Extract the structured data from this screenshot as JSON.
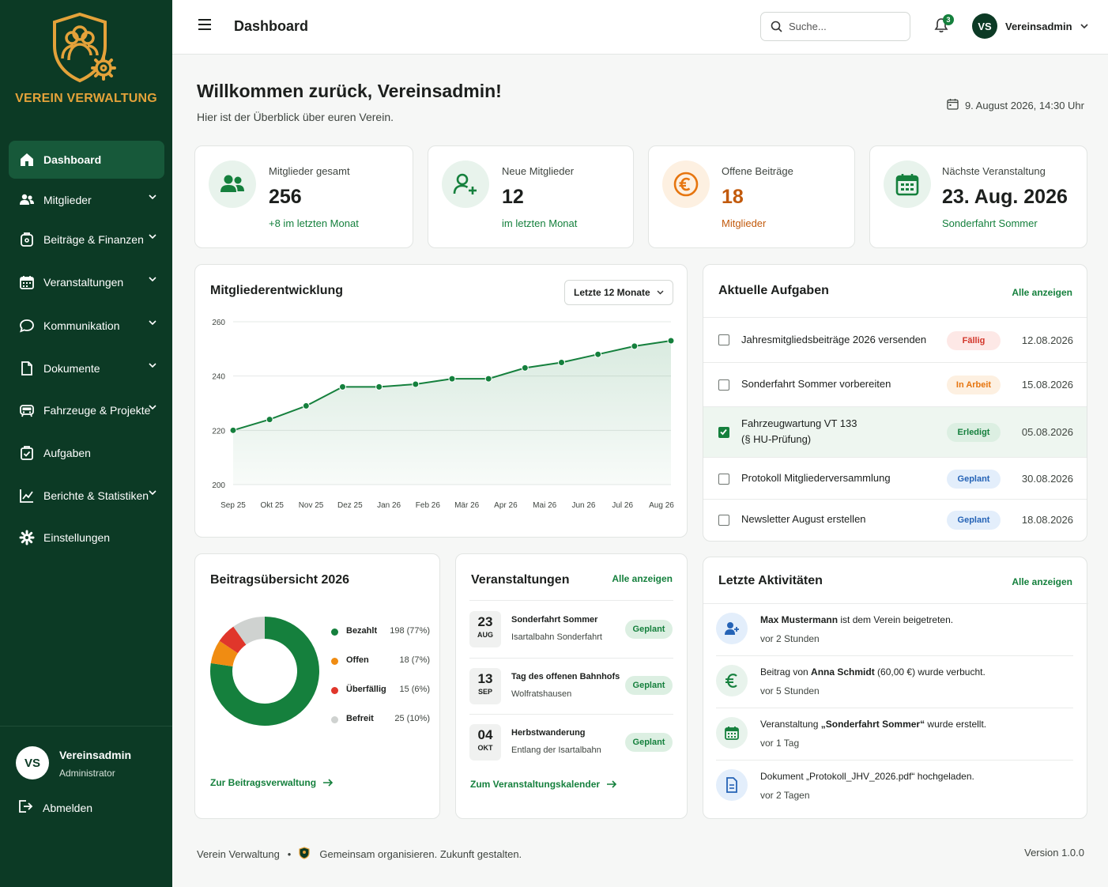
{
  "app": {
    "name": "VEREIN VERWALTUNG",
    "accent": "#15803d",
    "sidebar_bg": "#0c3a25",
    "brand_gold": "#e4a23a"
  },
  "sidebar": {
    "items": [
      {
        "label": "Dashboard",
        "icon": "home-icon",
        "active": true
      },
      {
        "label": "Mitglieder",
        "icon": "users-icon"
      },
      {
        "label": "Beiträge & Finanzen",
        "icon": "wallet-icon"
      },
      {
        "label": "Veranstaltungen",
        "icon": "calendar-icon"
      },
      {
        "label": "Kommunikation",
        "icon": "chat-icon"
      },
      {
        "label": "Dokumente",
        "icon": "document-icon"
      },
      {
        "label": "Fahrzeuge & Projekte",
        "icon": "vehicle-icon"
      },
      {
        "label": "Aufgaben",
        "icon": "task-icon"
      },
      {
        "label": "Berichte & Statistiken",
        "icon": "chart-icon"
      },
      {
        "label": "Einstellungen",
        "icon": "gear-icon"
      }
    ],
    "user": {
      "initials": "VS",
      "name": "Vereinsadmin",
      "role": "Administrator"
    },
    "logout_label": "Abmelden"
  },
  "topbar": {
    "title": "Dashboard",
    "search_placeholder": "Suche...",
    "notifications": "3",
    "user_initials": "VS",
    "user_name": "Vereinsadmin"
  },
  "welcome": {
    "title": "Willkommen zurück, Vereinsadmin!",
    "subtitle": "Hier ist der Überblick über euren Verein.",
    "datetime": "9. August 2026, 14:30 Uhr"
  },
  "stats": [
    {
      "label": "Mitglieder gesamt",
      "value": "256",
      "note": "+8 im letzten Monat"
    },
    {
      "label": "Neue Mitglieder",
      "value": "12",
      "note": "im letzten Monat"
    },
    {
      "label": "Offene Beiträge",
      "value": "18",
      "note": "Mitglieder"
    },
    {
      "label": "Nächste Veranstaltung",
      "value": "23. Aug. 2026",
      "note": "Sonderfahrt Sommer"
    }
  ],
  "member_chart": {
    "title": "Mitgliederentwicklung",
    "range_label": "Letzte 12 Monate"
  },
  "chart_data": {
    "type": "area",
    "categories": [
      "Sep 25",
      "Okt 25",
      "Nov 25",
      "Dez 25",
      "Jan 26",
      "Feb 26",
      "Mär 26",
      "Apr 26",
      "Mai 26",
      "Jun 26",
      "Jul 26",
      "Aug 26"
    ],
    "series": [
      {
        "values": [
          220,
          224,
          229,
          236,
          236,
          237,
          239,
          239,
          243,
          245,
          248,
          251,
          253
        ]
      }
    ],
    "yticks": [
      200,
      220,
      240,
      260
    ],
    "ylim": [
      200,
      260
    ],
    "grid": true,
    "color": "#15803d"
  },
  "tasks": {
    "title": "Aktuelle Aufgaben",
    "link": "Alle anzeigen",
    "items": [
      {
        "text": "Jahresmitgliedsbeiträge 2026 versenden",
        "status": "Fällig",
        "date": "12.08.2026",
        "done": false
      },
      {
        "text": "Sonderfahrt Sommer vorbereiten",
        "status": "In Arbeit",
        "date": "15.08.2026",
        "done": false
      },
      {
        "text": "Fahrzeugwartung VT 133",
        "text2": "(§ HU-Prüfung)",
        "status": "Erledigt",
        "date": "05.08.2026",
        "done": true
      },
      {
        "text": "Protokoll Mitgliederversammlung",
        "status": "Geplant",
        "date": "30.08.2026",
        "done": false
      },
      {
        "text": "Newsletter August erstellen",
        "status": "Geplant",
        "date": "18.08.2026",
        "done": false
      }
    ]
  },
  "fees": {
    "title": "Beitragsübersicht 2026",
    "link": "Zur Beitragsverwaltung",
    "legend": [
      {
        "label": "Bezahlt",
        "value": "198 (77%)",
        "count": 198,
        "color": "#15803d"
      },
      {
        "label": "Offen",
        "value": "18 (7%)",
        "count": 18,
        "color": "#f08c12"
      },
      {
        "label": "Überfällig",
        "value": "15 (6%)",
        "count": 15,
        "color": "#e0362b"
      },
      {
        "label": "Befreit",
        "value": "25 (10%)",
        "count": 25,
        "color": "#cfd2d0"
      }
    ]
  },
  "events": {
    "title": "Veranstaltungen",
    "link": "Alle anzeigen",
    "footer_link": "Zum Veranstaltungskalender",
    "items": [
      {
        "day": "23",
        "month": "AUG",
        "title": "Sonderfahrt Sommer",
        "place": "Isartalbahn Sonderfahrt",
        "status": "Geplant"
      },
      {
        "day": "13",
        "month": "SEP",
        "title": "Tag des offenen Bahnhofs",
        "place": "Wolfratshausen",
        "status": "Geplant"
      },
      {
        "day": "04",
        "month": "OKT",
        "title": "Herbstwanderung",
        "place": "Entlang der Isartalbahn",
        "status": "Geplant"
      }
    ]
  },
  "activities": {
    "title": "Letzte Aktivitäten",
    "link": "Alle anzeigen",
    "items": [
      {
        "bold": "Max Mustermann",
        "rest": " ist dem Verein beigetreten.",
        "time": "vor 2 Stunden",
        "icon": "user-plus-icon"
      },
      {
        "pre": "Beitrag von ",
        "bold": "Anna Schmidt",
        "rest": " (60,00 €) wurde verbucht.",
        "time": "vor 5 Stunden",
        "icon": "euro-icon"
      },
      {
        "pre": "Veranstaltung ",
        "bold": "„Sonderfahrt Sommer“",
        "rest": " wurde erstellt.",
        "time": "vor 1 Tag",
        "icon": "calendar-icon"
      },
      {
        "pre": "Dokument „Protokoll_JHV_2026.pdf“ hochgeladen.",
        "time": "vor 2 Tagen",
        "icon": "document-icon"
      }
    ]
  },
  "footer": {
    "brand": "Verein Verwaltung",
    "separator": "•",
    "tagline": "Gemeinsam organisieren. Zukunft gestalten.",
    "version": "Version 1.0.0"
  }
}
